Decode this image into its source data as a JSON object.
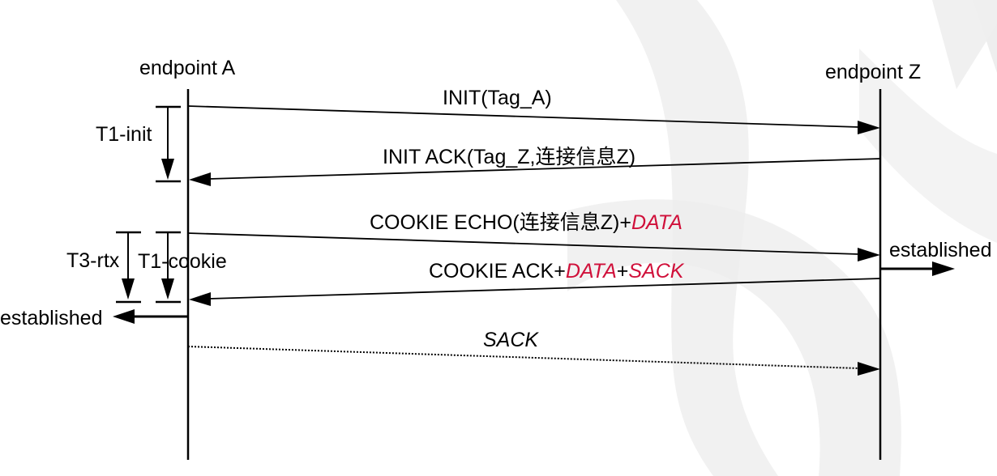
{
  "endpoints": {
    "a": "endpoint A",
    "z": "endpoint Z"
  },
  "messages": {
    "init": {
      "text": "INIT(Tag_A)"
    },
    "init_ack": {
      "text": "INIT ACK(Tag_Z,连接信息Z)"
    },
    "cookie_echo": {
      "pre": "COOKIE ECHO(连接信息Z)+",
      "data": "DATA"
    },
    "cookie_ack": {
      "pre": "COOKIE ACK+",
      "data": "DATA",
      "plus": "+",
      "sack": "SACK"
    },
    "sack": {
      "text": "SACK"
    }
  },
  "timers": {
    "t1_init": "T1-init",
    "t3_rtx": "T3-rtx",
    "t1_cookie": "T1-cookie"
  },
  "states": {
    "left": "established",
    "right": "established"
  },
  "colors": {
    "line": "#000000",
    "highlight": "#d0103a",
    "watermark": "#eeeeee"
  }
}
